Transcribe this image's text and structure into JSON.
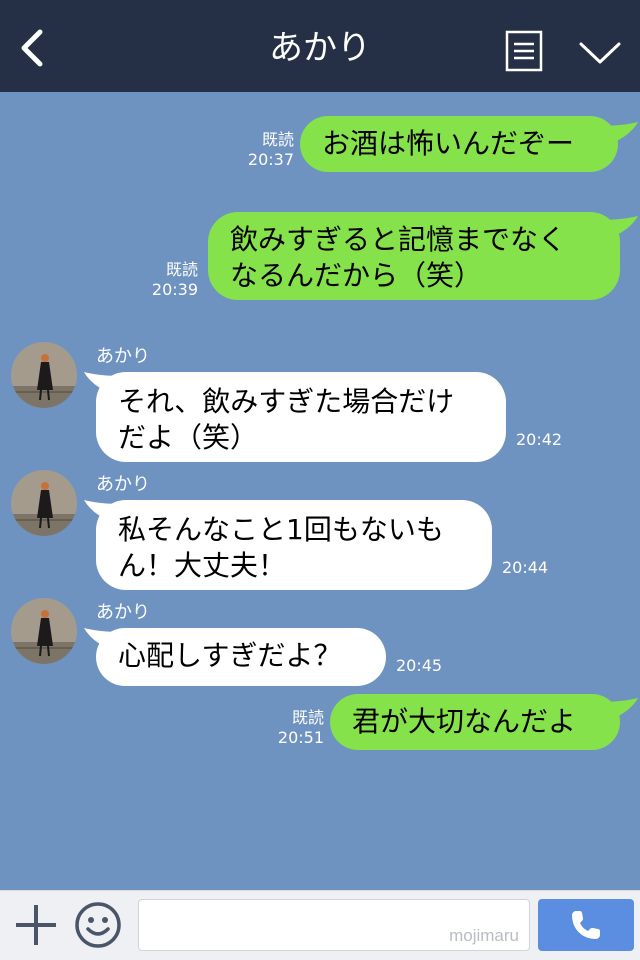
{
  "header": {
    "title": "あかり"
  },
  "messages": {
    "out1": {
      "text": "お酒は怖いんだぞー",
      "read": "既読",
      "time": "20:37"
    },
    "out2": {
      "line1": "飲みすぎると記憶までなく",
      "line2": "なるんだから（笑）",
      "read": "既読",
      "time": "20:39"
    },
    "in1": {
      "sender": "あかり",
      "line1": "それ、飲みすぎた場合だけ",
      "line2": "だよ（笑）",
      "time": "20:42"
    },
    "in2": {
      "sender": "あかり",
      "line1": "私そんなこと1回もないも",
      "line2": "ん！大丈夫！",
      "time": "20:44"
    },
    "in3": {
      "sender": "あかり",
      "text": "心配しすぎだよ？",
      "time": "20:45"
    },
    "out3": {
      "text": "君が大切なんだよ",
      "read": "既読",
      "time": "20:51"
    }
  },
  "footer": {
    "watermark": "mojimaru"
  },
  "colors": {
    "header_bg": "#252f45",
    "chat_bg": "#6f93c1",
    "bubble_out": "#85e24a",
    "bubble_in": "#ffffff",
    "call_button": "#5b8de0"
  },
  "icons": [
    "back-arrow-icon",
    "menu-list-icon",
    "chevron-down-icon",
    "plus-icon",
    "emoji-icon",
    "phone-icon"
  ]
}
